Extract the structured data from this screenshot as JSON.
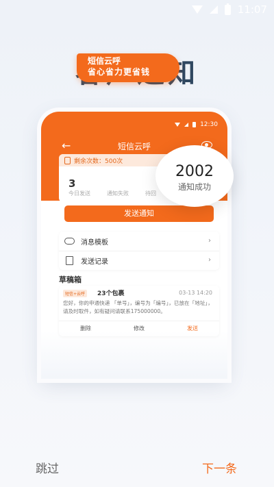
{
  "status_bar": {
    "time": "11:07"
  },
  "hero": {
    "title": "客户通知"
  },
  "app": {
    "status_time": "12:30",
    "title": "短信云呼",
    "remaining": "剩余次数：500次",
    "stat_number": "3",
    "stat_labels": [
      "今日发送",
      "通知失败",
      "待回"
    ],
    "promo_line1": "短信云呼",
    "promo_line2": "省心省力更省钱",
    "success_count": "2002",
    "success_label": "通知成功",
    "send_button": "发送通知",
    "menu": [
      {
        "label": "消息模板",
        "icon": "cloud-icon"
      },
      {
        "label": "发送记录",
        "icon": "clipboard-icon"
      }
    ],
    "drafts_title": "草稿箱",
    "draft": {
      "tag": "短信+云呼",
      "name": "23个包裹",
      "time": "03-13  14:20",
      "body": "您好，你的申通快递 「单号」，编号为「编号」，已放在「地址」，请及时取件，如有疑问请联系175000000。",
      "actions": [
        "删除",
        "修改",
        "发送"
      ]
    }
  },
  "footer": {
    "skip": "跳过",
    "next": "下一条"
  },
  "colors": {
    "accent": "#f36a1c",
    "title": "#2f4760"
  }
}
